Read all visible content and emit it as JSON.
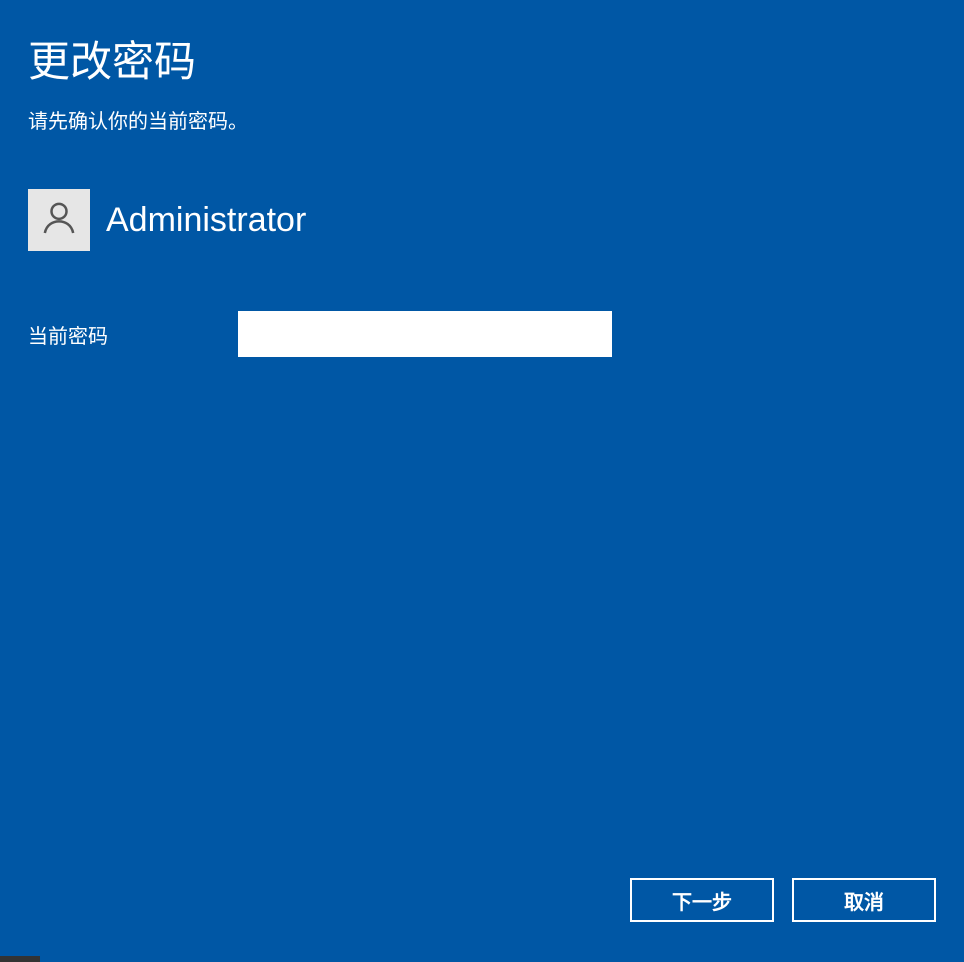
{
  "header": {
    "title": "更改密码",
    "subtitle": "请先确认你的当前密码。"
  },
  "user": {
    "name": "Administrator"
  },
  "field": {
    "current_password_label": "当前密码",
    "current_password_value": ""
  },
  "buttons": {
    "next": "下一步",
    "cancel": "取消"
  },
  "colors": {
    "background": "#0057A5",
    "text": "#ffffff",
    "input_bg": "#ffffff",
    "avatar_bg": "#e6e6e6"
  }
}
